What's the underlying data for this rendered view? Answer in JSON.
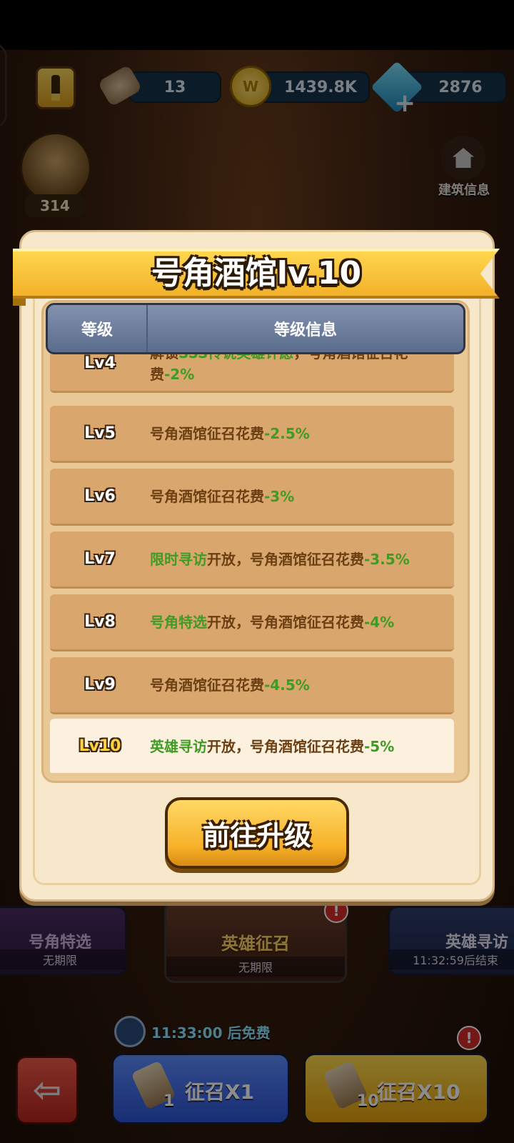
{
  "resources": {
    "scroll_count": "13",
    "gold": "1439.8K",
    "gems": "2876",
    "horn_count": "314"
  },
  "building_info_label": "建筑信息",
  "categories": [
    {
      "title": "号角特选",
      "sub": "无期限"
    },
    {
      "title": "英雄征召",
      "sub": "无期限"
    },
    {
      "title": "英雄寻访",
      "sub": "11:32:59后结束"
    }
  ],
  "free_timer": "11:33:00 后免费",
  "summon": {
    "x1_label": "征召X1",
    "x1_count": "1",
    "x10_label": "征召X10",
    "x10_count": "10"
  },
  "modal": {
    "title": "号角酒馆lv.10",
    "header_level": "等级",
    "header_info": "等级信息",
    "rows": [
      {
        "level": "Lv4",
        "parts": [
          {
            "t": "解锁",
            "hl": false
          },
          {
            "t": "SSS传说英雄许愿",
            "hl": true
          },
          {
            "t": "，号角酒馆征召花费",
            "hl": false
          },
          {
            "t": "-2%",
            "hl": true
          }
        ]
      },
      {
        "level": "Lv5",
        "parts": [
          {
            "t": "号角酒馆征召花费",
            "hl": false
          },
          {
            "t": "-2.5%",
            "hl": true
          }
        ]
      },
      {
        "level": "Lv6",
        "parts": [
          {
            "t": "号角酒馆征召花费",
            "hl": false
          },
          {
            "t": "-3%",
            "hl": true
          }
        ]
      },
      {
        "level": "Lv7",
        "parts": [
          {
            "t": "限时寻访",
            "hl": true
          },
          {
            "t": "开放，号角酒馆征召花费",
            "hl": false
          },
          {
            "t": "-3.5%",
            "hl": true
          }
        ]
      },
      {
        "level": "Lv8",
        "parts": [
          {
            "t": "号角特选",
            "hl": true
          },
          {
            "t": "开放，号角酒馆征召花费",
            "hl": false
          },
          {
            "t": "-4%",
            "hl": true
          }
        ]
      },
      {
        "level": "Lv9",
        "parts": [
          {
            "t": "号角酒馆征召花费",
            "hl": false
          },
          {
            "t": "-4.5%",
            "hl": true
          }
        ]
      },
      {
        "level": "Lv10",
        "current": true,
        "parts": [
          {
            "t": "英雄寻访",
            "hl": true
          },
          {
            "t": "开放，号角酒馆征召花费",
            "hl": false
          },
          {
            "t": "-5%",
            "hl": true
          }
        ]
      }
    ],
    "go_upgrade_label": "前往升级"
  },
  "colors": {
    "highlight_green": "#3f9b23",
    "info_brown": "#6b3f12",
    "current_level_gold": "#ffd23d",
    "ribbon_yellow": "#f3b12a"
  }
}
